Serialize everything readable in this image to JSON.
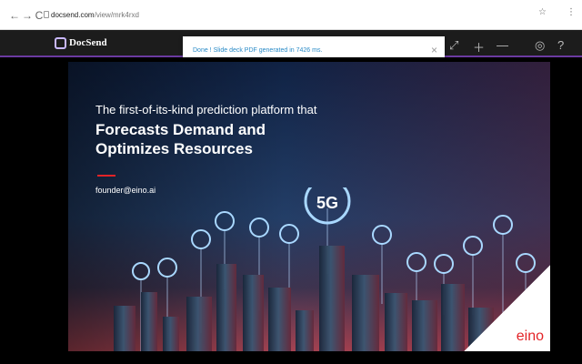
{
  "browser": {
    "back": "←",
    "forward": "→",
    "reload": "C",
    "url_domain": "docsend.com",
    "url_path": "/view/mrk4rxd",
    "bookmark_icon": "star-icon",
    "menu_icon": "more-vertical-icon"
  },
  "app": {
    "name": "DocSend",
    "icons": [
      "expand-icon",
      "plus-icon",
      "minus-icon",
      "comment-icon",
      "help-icon"
    ]
  },
  "toast": {
    "message": "Done ! Slide deck PDF generated in 7426 ms.",
    "close": "×"
  },
  "slide": {
    "kicker": "The first-of-its-kind prediction platform that",
    "headline_1": "Forecasts Demand and",
    "headline_2": "Optimizes Resources",
    "email": "founder@eino.ai",
    "badge": "5G",
    "brand": "eino"
  },
  "colors": {
    "accent": "#6b3aa1",
    "toast_text": "#2a8bc7",
    "slide_red": "#e32327"
  }
}
